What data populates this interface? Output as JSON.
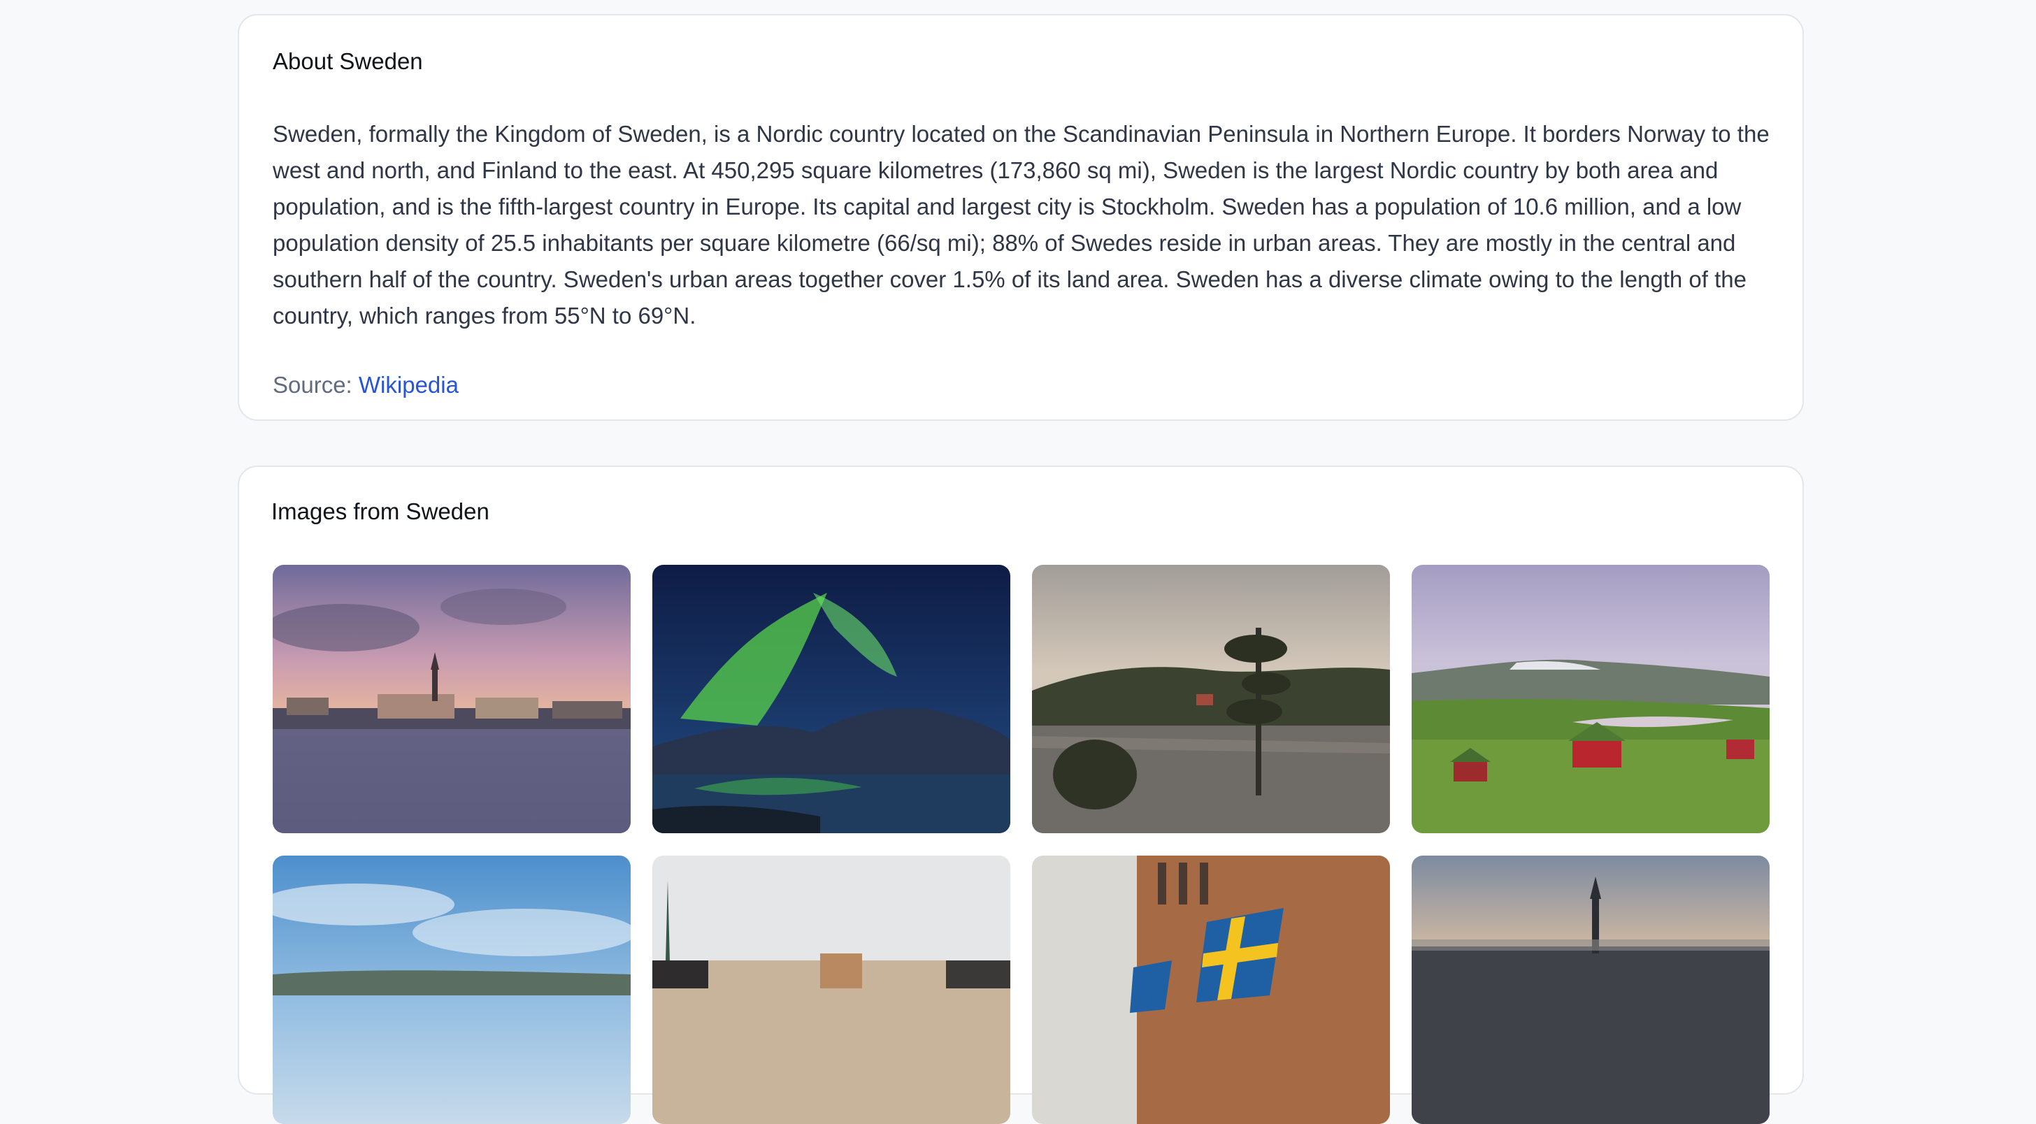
{
  "about": {
    "title": "About Sweden",
    "text": "Sweden, formally the Kingdom of Sweden, is a Nordic country located on the Scandinavian Peninsula in Northern Europe. It borders Norway to the west and north, and Finland to the east. At 450,295 square kilometres (173,860 sq mi), Sweden is the largest Nordic country by both area and population, and is the fifth-largest country in Europe. Its capital and largest city is Stockholm. Sweden has a population of 10.6 million, and a low population density of 25.5 inhabitants per square kilometre (66/sq mi); 88% of Swedes reside in urban areas. They are mostly in the central and southern half of the country. Sweden's urban areas together cover 1.5% of its land area. Sweden has a diverse climate owing to the length of the country, which ranges from 55°N to 69°N.",
    "source_label": "Source:",
    "source_link": "Wikipedia"
  },
  "images": {
    "title": "Images from Sweden",
    "photos": [
      {
        "subject": "stockholm-sunset-cityscape"
      },
      {
        "subject": "northern-lights-over-lake"
      },
      {
        "subject": "lake-with-pine-trees-and-red-cabin"
      },
      {
        "subject": "red-cabins-in-green-valley"
      },
      {
        "subject": "blue-sky-over-landscape"
      },
      {
        "subject": "old-town-rooftops"
      },
      {
        "subject": "swedish-flags-on-building"
      },
      {
        "subject": "stockholm-skyline-dusk"
      }
    ]
  },
  "colors": {
    "page_background": "#f8f9fb",
    "card_background": "#ffffff",
    "card_border": "#e3e6eb",
    "link": "#2755d9",
    "body_text": "#2f3645",
    "muted_text": "#626b7b"
  }
}
